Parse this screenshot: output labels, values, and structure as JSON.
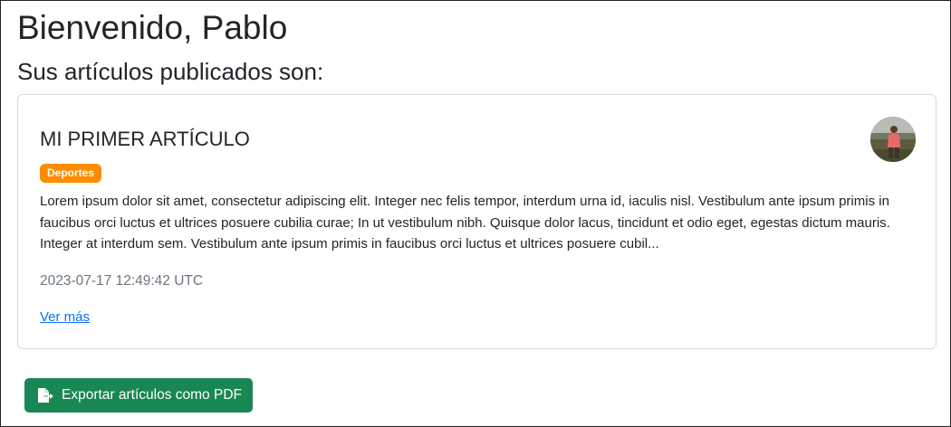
{
  "header": {
    "welcome": "Bienvenido, Pablo",
    "subtitle": "Sus artículos publicados son:"
  },
  "articles": [
    {
      "title": "MI PRIMER ARTÍCULO",
      "category": "Deportes",
      "excerpt": "Lorem ipsum dolor sit amet, consectetur adipiscing elit. Integer nec felis tempor, interdum urna id, iaculis nisl. Vestibulum ante ipsum primis in faucibus orci luctus et ultrices posuere cubilia curae; In ut vestibulum nibh. Quisque dolor lacus, tincidunt et odio eget, egestas dictum mauris. Integer at interdum sem. Vestibulum ante ipsum primis in faucibus orci luctus et ultrices posuere cubil...",
      "timestamp": "2023-07-17 12:49:42 UTC",
      "more_label": "Ver más",
      "author_avatar_icon": "user-avatar-photo"
    }
  ],
  "actions": {
    "export_label": "Exportar artículos como PDF",
    "export_icon": "file-export-icon"
  },
  "colors": {
    "badge": "#fd8c00",
    "link": "#0d6efd",
    "export_button": "#198754",
    "muted_text": "#6c757d"
  }
}
